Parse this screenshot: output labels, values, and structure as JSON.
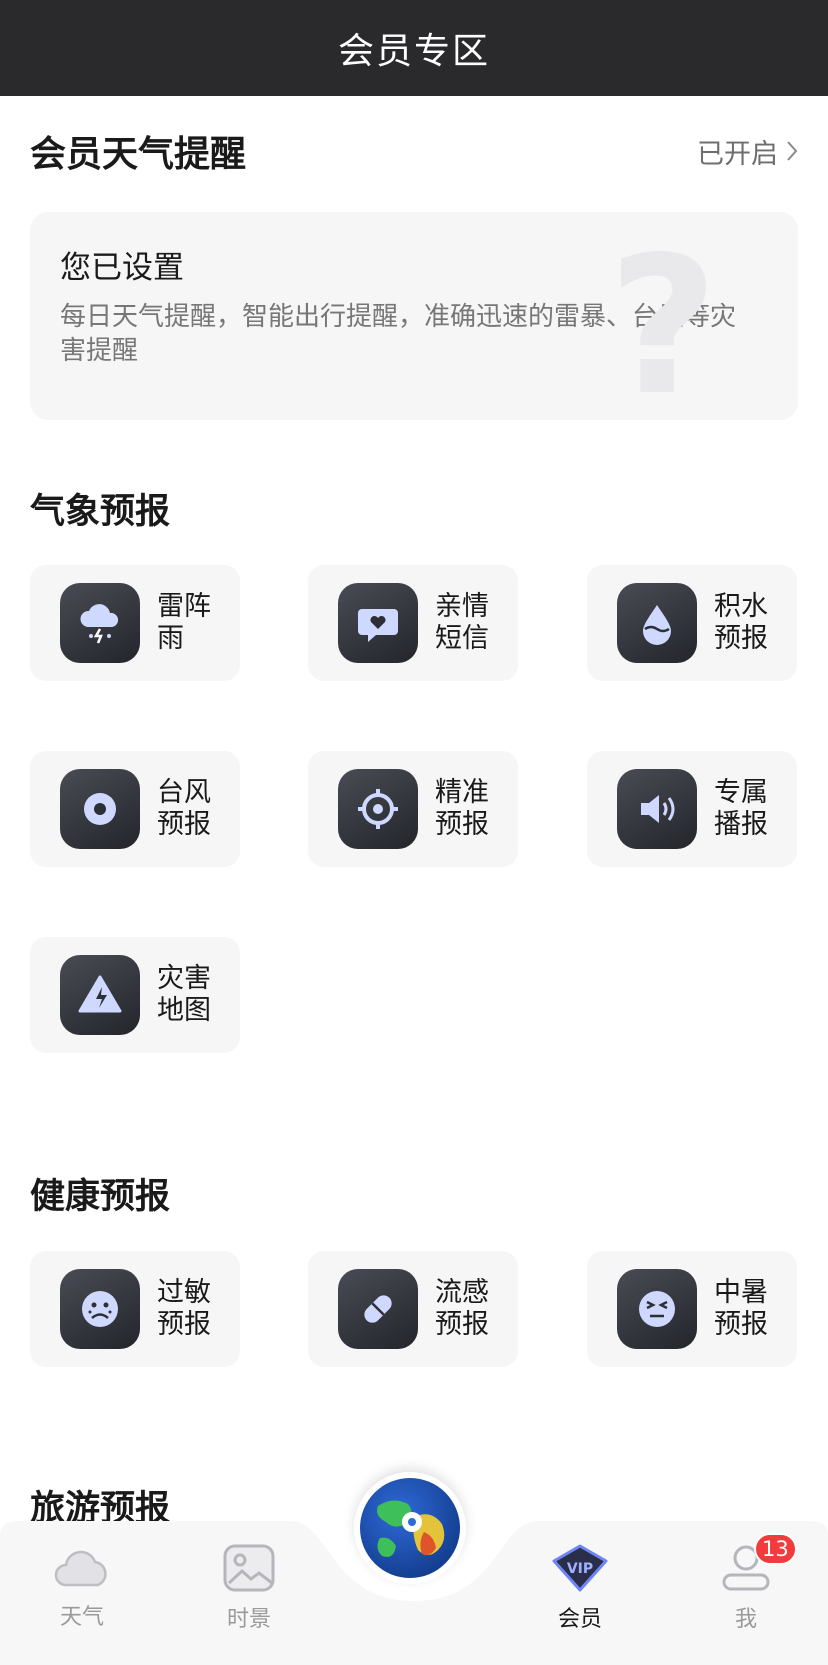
{
  "header": {
    "title": "会员专区"
  },
  "reminder": {
    "title": "会员天气提醒",
    "status": "已开启"
  },
  "setting_card": {
    "title": "您已设置",
    "description": "每日天气提醒，智能出行提醒，准确迅速的雷暴、台风等灾害提醒"
  },
  "sections": {
    "meteorology": {
      "title": "气象预报",
      "items": [
        {
          "label": "雷阵雨",
          "icon": "thunderstorm-icon"
        },
        {
          "label": "亲情短信",
          "icon": "message-heart-icon"
        },
        {
          "label": "积水预报",
          "icon": "water-drop-icon"
        },
        {
          "label": "台风预报",
          "icon": "typhoon-icon"
        },
        {
          "label": "精准预报",
          "icon": "crosshair-icon"
        },
        {
          "label": "专属播报",
          "icon": "speaker-icon"
        },
        {
          "label": "灾害地图",
          "icon": "warning-triangle-icon"
        }
      ]
    },
    "health": {
      "title": "健康预报",
      "items": [
        {
          "label": "过敏预报",
          "icon": "sad-face-icon"
        },
        {
          "label": "流感预报",
          "icon": "pill-icon"
        },
        {
          "label": "中暑预报",
          "icon": "dizzy-face-icon"
        }
      ]
    },
    "travel": {
      "title": "旅游预报"
    }
  },
  "tabbar": {
    "tabs": [
      {
        "label": "天气",
        "icon": "cloud-icon"
      },
      {
        "label": "时景",
        "icon": "image-icon"
      },
      {
        "label": "会员",
        "icon": "vip-icon"
      },
      {
        "label": "我",
        "icon": "user-icon",
        "badge": "13"
      }
    ],
    "active": "会员"
  },
  "colors": {
    "header_bg": "#2a2a2d",
    "card_bg": "#f6f6f7",
    "icon_accent": "#cfd8ff",
    "badge": "#f23b3b"
  }
}
